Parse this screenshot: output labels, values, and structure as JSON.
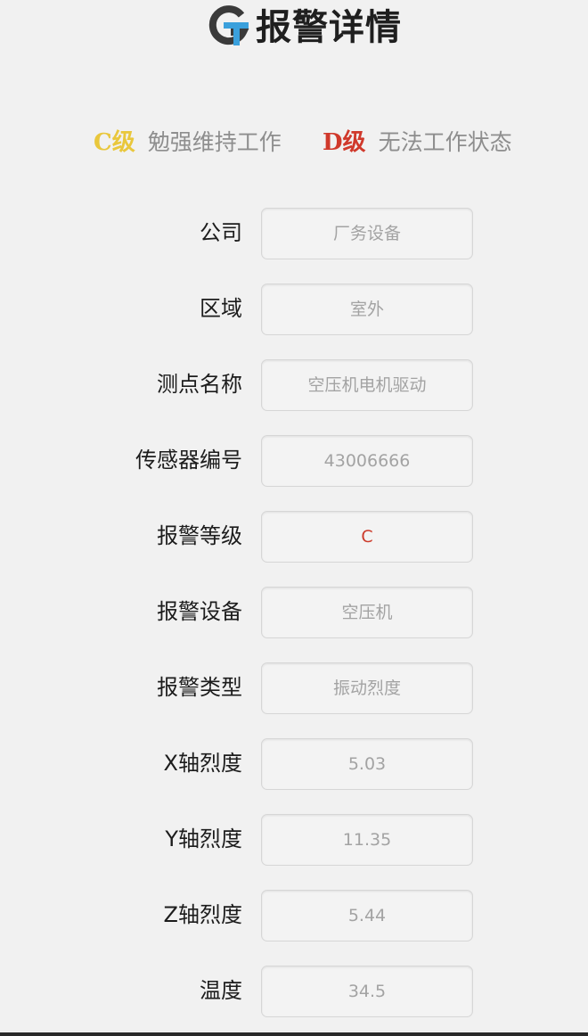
{
  "header": {
    "title": "报警详情",
    "logo_icon": "gt-logo",
    "logo_colors": {
      "g": "#3a3a3a",
      "t": "#3aa0dc"
    }
  },
  "legend": [
    {
      "grade": "C级",
      "description": "勉强维持工作",
      "color": "#e9c73c"
    },
    {
      "grade": "D级",
      "description": "无法工作状态",
      "color": "#d0392b"
    }
  ],
  "details": [
    {
      "label": "公司",
      "value": "厂务设备"
    },
    {
      "label": "区域",
      "value": "室外"
    },
    {
      "label": "测点名称",
      "value": "空压机电机驱动"
    },
    {
      "label": "传感器编号",
      "value": "43006666"
    },
    {
      "label": "报警等级",
      "value": "C",
      "highlight": true,
      "color": "#cc3a2a"
    },
    {
      "label": "报警设备",
      "value": "空压机"
    },
    {
      "label": "报警类型",
      "value": "振动烈度"
    },
    {
      "label": "X轴烈度",
      "value": "5.03"
    },
    {
      "label": "Y轴烈度",
      "value": "11.35"
    },
    {
      "label": "Z轴烈度",
      "value": "5.44"
    },
    {
      "label": "温度",
      "value": "34.5"
    }
  ]
}
